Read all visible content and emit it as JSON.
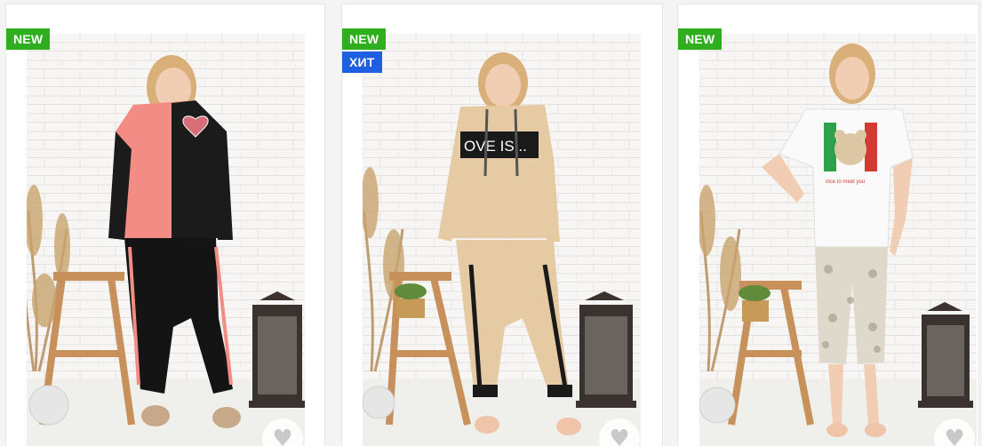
{
  "products": [
    {
      "badges": [
        "NEW"
      ],
      "image_alt": "Girl in pink and black hoodie tracksuit",
      "favorite_icon": "heart-icon"
    },
    {
      "badges": [
        "NEW",
        "ХИТ"
      ],
      "image_alt": "Girl in beige tracksuit with LOVE IS print",
      "favorite_icon": "heart-icon"
    },
    {
      "badges": [
        "NEW"
      ],
      "image_alt": "Girl in white t-shirt with teddy bear print and capri pants",
      "favorite_icon": "heart-icon"
    }
  ],
  "print_texts": {
    "loveis": "OVE IS...",
    "tshirt": "nice to meet you"
  },
  "colors": {
    "new_badge": "#2fae1e",
    "hit_badge": "#1d5fe0"
  },
  "icons": {
    "heart": "♥"
  }
}
